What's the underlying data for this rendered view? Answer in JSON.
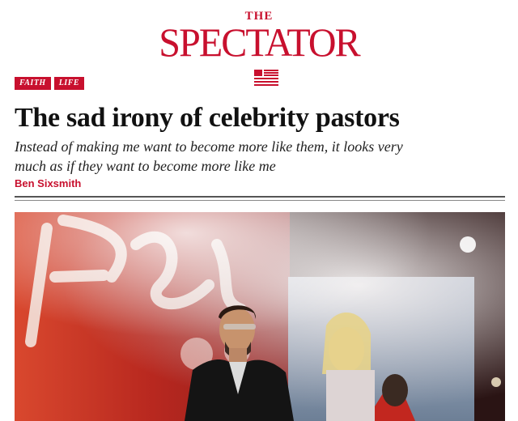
{
  "brand": {
    "the": "THE",
    "name": "SPECTATOR",
    "accent_color": "#c8102e",
    "menu_icon": "hamburger-flag-icon"
  },
  "tags": [
    "FAITH",
    "LIFE"
  ],
  "article": {
    "headline": "The sad irony of celebrity pastors",
    "standfirst": "Instead of making me want to become more like them, it looks very much as if they want to become more like me",
    "author": "Ben Sixsmith"
  },
  "hero_image": {
    "subject": "photo of pastor on stage with screen and haze"
  }
}
